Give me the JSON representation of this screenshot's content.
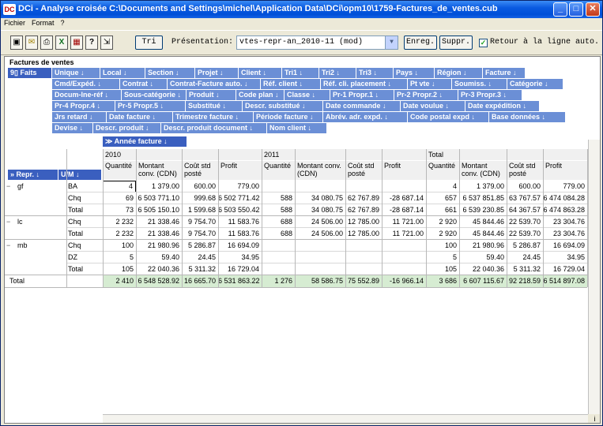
{
  "window": {
    "icon_text": "DC",
    "title": "DCi - Analyse croisée C:\\Documents and Settings\\michel\\Application Data\\DCi\\opm10\\1759-Factures_de_ventes.cub",
    "minimize": "_",
    "maximize": "□",
    "close": "✕"
  },
  "menu": [
    "Fichier",
    "Format",
    "?"
  ],
  "toolbar": {
    "icons": [
      "save-icon",
      "mail-icon",
      "print-icon",
      "excel-icon",
      "calculator-icon",
      "help-icon",
      "exit-icon"
    ],
    "icon_glyphs": [
      "▣",
      "✉",
      "⎙",
      "X",
      "▦",
      "?",
      "⇲"
    ],
    "tri_label": "Tri",
    "presentation_label": "Présentation:",
    "presentation_value": "vtes-repr-an_2010-11 (mod)",
    "enreg_label": "Enreg.",
    "suppr_label": "Suppr.",
    "retour_label": "Retour à la ligne auto.",
    "retour_checked": true
  },
  "cube": {
    "title": "Factures de ventes",
    "faits_label": "9▯ Faits",
    "dimension_rows": [
      [
        "Unique ↓",
        "Local ↓",
        "Section ↓",
        "Projet ↓",
        "Client ↓",
        "Tri1 ↓",
        "Tri2 ↓",
        "Tri3 ↓",
        "Pays ↓",
        "Région ↓",
        "Facture ↓"
      ],
      [
        "Cmd/Expéd. ↓",
        "Contrat ↓",
        "Contrat-Facture auto. ↓",
        "Réf. client ↓",
        "Réf. cli. placement ↓",
        "Pt vte ↓",
        "Soumiss. ↓",
        "Catégorie ↓"
      ],
      [
        "Docum-lne-réf ↓",
        "Sous-catégorie ↓",
        "Produit ↓",
        "Code plan ↓",
        "Classe ↓",
        "Pr-1 Propr.1 ↓",
        "Pr-2 Propr.2 ↓",
        "Pr-3 Propr.3 ↓"
      ],
      [
        "Pr-4 Propr.4 ↓",
        "Pr-5 Propr.5 ↓",
        "Substitué ↓",
        "Descr. substitué ↓",
        "Date commande ↓",
        "Date voulue ↓",
        "Date expédition ↓"
      ],
      [
        "Jrs retard ↓",
        "Date facture ↓",
        "Trimestre facture ↓",
        "Période facture ↓",
        "Abrév. adr. expd. ↓",
        "Code postal expd ↓",
        "Base données ↓"
      ],
      [
        "Devise ↓",
        "Descr. produit ↓",
        "Descr. produit document ↓",
        "Nom client ↓"
      ]
    ],
    "col_dim": "≫ Année facture ↓",
    "row_dims": [
      "» Repr. ↓",
      "U/M ↓"
    ]
  },
  "table": {
    "years": [
      "2010",
      "2011",
      "Total"
    ],
    "measures": [
      "Quantité",
      "Montant conv. (CDN)",
      "Coût std posté",
      "Profit"
    ],
    "groups": [
      {
        "repr": "gf",
        "rows": [
          {
            "um": "BA",
            "vals": [
              "4",
              "1 379.00",
              "600.00",
              "779.00",
              "",
              "",
              "",
              "",
              "4",
              "1 379.00",
              "600.00",
              "779.00"
            ]
          },
          {
            "um": "Chq",
            "vals": [
              "69",
              "6 503 771.10",
              "999.68",
              "6 502 771.42",
              "588",
              "34 080.75",
              "62 767.89",
              "-28 687.14",
              "657",
              "6 537 851.85",
              "63 767.57",
              "6 474 084.28"
            ]
          },
          {
            "um": "Total",
            "vals": [
              "73",
              "6 505 150.10",
              "1 599.68",
              "6 503 550.42",
              "588",
              "34 080.75",
              "62 767.89",
              "-28 687.14",
              "661",
              "6 539 230.85",
              "64 367.57",
              "6 474 863.28"
            ]
          }
        ]
      },
      {
        "repr": "lc",
        "rows": [
          {
            "um": "Chq",
            "vals": [
              "2 232",
              "21 338.46",
              "9 754.70",
              "11 583.76",
              "688",
              "24 506.00",
              "12 785.00",
              "11 721.00",
              "2 920",
              "45 844.46",
              "22 539.70",
              "23 304.76"
            ]
          },
          {
            "um": "Total",
            "vals": [
              "2 232",
              "21 338.46",
              "9 754.70",
              "11 583.76",
              "688",
              "24 506.00",
              "12 785.00",
              "11 721.00",
              "2 920",
              "45 844.46",
              "22 539.70",
              "23 304.76"
            ]
          }
        ]
      },
      {
        "repr": "mb",
        "rows": [
          {
            "um": "Chq",
            "vals": [
              "100",
              "21 980.96",
              "5 286.87",
              "16 694.09",
              "",
              "",
              "",
              "",
              "100",
              "21 980.96",
              "5 286.87",
              "16 694.09"
            ]
          },
          {
            "um": "DZ",
            "vals": [
              "5",
              "59.40",
              "24.45",
              "34.95",
              "",
              "",
              "",
              "",
              "5",
              "59.40",
              "24.45",
              "34.95"
            ]
          },
          {
            "um": "Total",
            "vals": [
              "105",
              "22 040.36",
              "5 311.32",
              "16 729.04",
              "",
              "",
              "",
              "",
              "105",
              "22 040.36",
              "5 311.32",
              "16 729.04"
            ]
          }
        ]
      }
    ],
    "grand_total_label": "Total",
    "grand_total": [
      "2 410",
      "6 548 528.92",
      "16 665.70",
      "6 531 863.22",
      "1 276",
      "58 586.75",
      "75 552.89",
      "-16 966.14",
      "3 686",
      "6 607 115.67",
      "92 218.59",
      "6 514 897.08"
    ],
    "corner_glyph": "i"
  }
}
